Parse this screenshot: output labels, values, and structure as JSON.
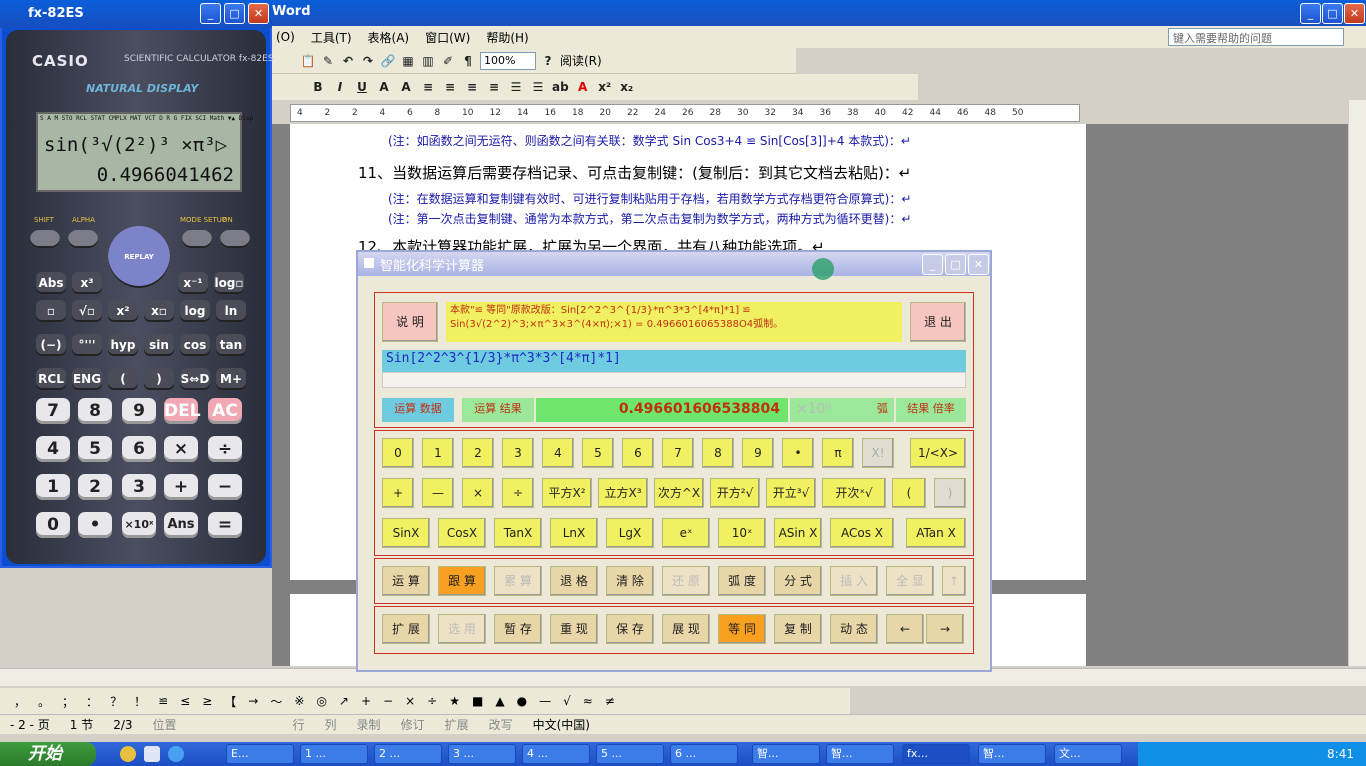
{
  "word": {
    "title": "Word",
    "menu": [
      "(O)",
      "工具(T)",
      "表格(A)",
      "窗口(W)",
      "帮助(H)"
    ],
    "help_placeholder": "键入需要帮助的问题",
    "zoom": "100%",
    "reading": "阅读(R)",
    "ruler": [
      "4",
      "2",
      "2",
      "4",
      "6",
      "8",
      "10",
      "12",
      "14",
      "16",
      "18",
      "20",
      "22",
      "24",
      "26",
      "28",
      "30",
      "32",
      "34",
      "36",
      "38",
      "40",
      "42",
      "44",
      "46",
      "48",
      "50"
    ],
    "doc": {
      "line1": "(注：如函数之间无运符、则函数之间有关联：数学式 Sin Cos3+4 ≌ Sin[Cos[3]]+4 本款式)：↵",
      "line2": "11、当数据运算后需要存档记录、可点击复制键：(复制后：到其它文档去粘贴)：↵",
      "line3": "(注：在数据运算和复制键有效时、可进行复制粘贴用于存档，若用数学方式存档更符合原算式)：↵",
      "line4": "(注：第一次点击复制键、通常为本款方式，第二次点击复制为数学方式，两种方式为循环更替)：↵",
      "line5": "12、本款计算器功能扩展，扩展为另一个界面，共有八种功能选项。↵"
    },
    "status": {
      "page": "- 2 - 页",
      "section": "1 节",
      "count": "2/3",
      "position": "位置",
      "line": "行",
      "col": "列",
      "rec": "录制",
      "rev": "修订",
      "ext": "扩展",
      "ovr": "改写",
      "lang": "中文(中国)"
    }
  },
  "casio": {
    "title": "fx-82ES",
    "brand": "CASIO",
    "model": "SCIENTIFIC CALCULATOR fx-82ES",
    "natural": "NATURAL DISPLAY",
    "indicator": "S A M STO RCL STAT CMPLX MAT VCT D R G FIX SCI Math ▼▲ Disp",
    "expr": "sin(³√(2²)³ ×π³▷",
    "result": "0.4966041462",
    "fn_row1": [
      "SHIFT",
      "ALPHA",
      "MODE SETUP",
      "ON"
    ],
    "replay": "REPLAY",
    "fn_row2": [
      "Abs",
      "x³",
      "x⁻¹",
      "log▫"
    ],
    "fn_row3": [
      "▫",
      "√▫",
      "x²",
      "x▫",
      "log",
      "ln"
    ],
    "fn_row4": [
      "(−)",
      "°'''",
      "hyp",
      "sin",
      "cos",
      "tan"
    ],
    "fn_row5": [
      "RCL",
      "ENG",
      "(",
      ")",
      "S⇔D",
      "M+"
    ],
    "num_row1": [
      "7",
      "8",
      "9",
      "DEL",
      "AC"
    ],
    "num_row2": [
      "4",
      "5",
      "6",
      "×",
      "÷"
    ],
    "num_row3": [
      "1",
      "2",
      "3",
      "+",
      "−"
    ],
    "num_row4": [
      "0",
      "•",
      "×10ˣ",
      "Ans",
      "="
    ]
  },
  "smart": {
    "title": "智能化科学计算器",
    "btn_explain": "说 明",
    "btn_exit": "退 出",
    "info": "本款\"≌ 等同\"原款改版：Sin[2^2^3^{1/3}*π^3*3^[4*π]*1] ≌ Sin(3√(2^2)^3;×π^3×3^(4×π);×1) = 0.4966016065388O4弧制。",
    "input": "Sin[2^2^3^{1/3}*π^3*3^[4*π]*1]",
    "lbl_data": "运算 数据",
    "lbl_result": "运算 结果",
    "result": "0.496601606538804",
    "power": "×10⁰",
    "arc": "弧",
    "multiple": "结果 倍率",
    "row1": [
      "0",
      "1",
      "2",
      "3",
      "4",
      "5",
      "6",
      "7",
      "8",
      "9",
      "•",
      "π",
      "X!",
      "1/<X>"
    ],
    "row2": [
      "+",
      "—",
      "×",
      "÷",
      "平方X²",
      "立方X³",
      "次方^X",
      "开方²√",
      "开立³√",
      "开次ˣ√",
      "(",
      ")"
    ],
    "row3": [
      "SinX",
      "CosX",
      "TanX",
      "LnX",
      "LgX",
      "eˣ",
      "10ˣ",
      "ASin X",
      "ACos X",
      "ATan X"
    ],
    "row4": [
      "运 算",
      "跟 算",
      "累 算",
      "退 格",
      "清 除",
      "还 原",
      "弧 度",
      "分 式",
      "插 入",
      "全 显",
      "↑"
    ],
    "row5": [
      "扩 展",
      "选 用",
      "暂 存",
      "重 现",
      "保 存",
      "展 现",
      "等 同",
      "复 制",
      "动 态",
      "←",
      "→"
    ]
  },
  "taskbar": {
    "start": "开始",
    "tasks": [
      "E...",
      "1 ...",
      "2 ...",
      "3 ...",
      "4 ...",
      "5 ...",
      "6 ...",
      "智...",
      "智...",
      "fx...",
      "智...",
      "文..."
    ],
    "clock": "8:41"
  }
}
